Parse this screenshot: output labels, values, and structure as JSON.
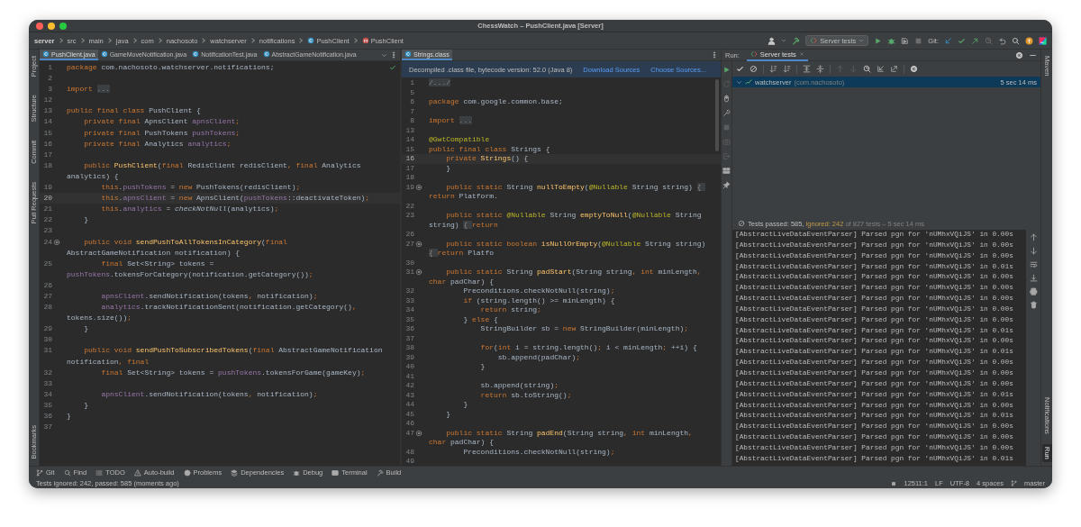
{
  "window": {
    "title": "ChessWatch – PushClient.java [Server]"
  },
  "navbar": {
    "breadcrumbs": [
      {
        "label": "server",
        "kind": "module"
      },
      {
        "label": "src",
        "kind": "folder"
      },
      {
        "label": "main",
        "kind": "folder"
      },
      {
        "label": "java",
        "kind": "folder"
      },
      {
        "label": "com",
        "kind": "folder"
      },
      {
        "label": "nachosoto",
        "kind": "folder"
      },
      {
        "label": "watchserver",
        "kind": "folder"
      },
      {
        "label": "notifications",
        "kind": "folder"
      },
      {
        "label": "PushClient",
        "kind": "class"
      },
      {
        "label": "PushClient",
        "kind": "method"
      }
    ],
    "run_configuration": "Server tests",
    "git_label": "Git:"
  },
  "left_strip": {
    "top": [
      {
        "label": "Project",
        "selected": false
      },
      {
        "label": "Structure",
        "selected": false
      },
      {
        "label": "Commit",
        "selected": false
      },
      {
        "label": "Pull Requests",
        "selected": false
      }
    ],
    "bottom": [
      {
        "label": "Bookmarks",
        "selected": false
      }
    ]
  },
  "editors": [
    {
      "tabs": [
        {
          "label": "PushClient.java",
          "selected": true
        },
        {
          "label": "GameMoveNotification.java",
          "selected": false
        },
        {
          "label": "NotificationTest.java",
          "selected": false
        },
        {
          "label": "AbstractGameNotification.java",
          "selected": false
        }
      ],
      "lines": [
        {
          "n": "1",
          "code": [
            {
              "kind": "keyword",
              "text": "package "
            },
            {
              "kind": "plain",
              "text": "com.nachosoto.watchserver.notifications;"
            }
          ]
        },
        {
          "n": "2"
        },
        {
          "n": "3",
          "code": [
            {
              "kind": "keyword",
              "text": "import "
            },
            {
              "kind": "folded",
              "text": "..."
            }
          ]
        },
        {
          "n": "12"
        },
        {
          "n": "13",
          "code": [
            {
              "kind": "keyword",
              "text": "public final class "
            },
            {
              "kind": "plain",
              "text": "PushClient {"
            }
          ]
        },
        {
          "n": "14",
          "code": [
            {
              "kind": "keyword",
              "text": "    private final "
            },
            {
              "kind": "plain",
              "text": "ApnsClient "
            },
            {
              "kind": "field",
              "text": "apnsClient"
            },
            {
              "kind": "keyword",
              "text": ";"
            }
          ]
        },
        {
          "n": "15",
          "code": [
            {
              "kind": "keyword",
              "text": "    private final "
            },
            {
              "kind": "plain",
              "text": "PushTokens "
            },
            {
              "kind": "field",
              "text": "pushTokens"
            },
            {
              "kind": "keyword",
              "text": ";"
            }
          ]
        },
        {
          "n": "16",
          "code": [
            {
              "kind": "keyword",
              "text": "    private final "
            },
            {
              "kind": "plain",
              "text": "Analytics "
            },
            {
              "kind": "field",
              "text": "analytics"
            },
            {
              "kind": "keyword",
              "text": ";"
            }
          ]
        },
        {
          "n": "17"
        },
        {
          "n": "18",
          "code": [
            {
              "kind": "keyword",
              "text": "    public "
            },
            {
              "kind": "declaration",
              "text": "PushClient"
            },
            {
              "kind": "plain",
              "text": "("
            },
            {
              "kind": "keyword",
              "text": "final "
            },
            {
              "kind": "plain",
              "text": "RedisClient redisClient"
            },
            {
              "kind": "keyword",
              "text": ", final "
            },
            {
              "kind": "plain",
              "text": "Analytics analytics) {"
            }
          ]
        },
        {
          "n": "19",
          "code": [
            {
              "kind": "keyword",
              "text": "        this"
            },
            {
              "kind": "plain",
              "text": "."
            },
            {
              "kind": "field",
              "text": "pushTokens"
            },
            {
              "kind": "plain",
              "text": " = "
            },
            {
              "kind": "keyword",
              "text": "new "
            },
            {
              "kind": "plain",
              "text": "PushTokens(redisClient)"
            },
            {
              "kind": "keyword",
              "text": ";"
            }
          ]
        },
        {
          "n": "20",
          "current": true,
          "code": [
            {
              "kind": "keyword",
              "text": "        this"
            },
            {
              "kind": "plain",
              "text": "."
            },
            {
              "kind": "field",
              "text": "apnsClient"
            },
            {
              "kind": "plain",
              "text": " = "
            },
            {
              "kind": "keyword",
              "text": "new "
            },
            {
              "kind": "plain",
              "text": "ApnsClient("
            },
            {
              "kind": "field",
              "text": "pushTokens"
            },
            {
              "kind": "plain",
              "text": "::deactivateToken)"
            },
            {
              "kind": "keyword",
              "text": ";"
            }
          ]
        },
        {
          "n": "21",
          "code": [
            {
              "kind": "keyword",
              "text": "        this"
            },
            {
              "kind": "plain",
              "text": "."
            },
            {
              "kind": "field",
              "text": "analytics"
            },
            {
              "kind": "plain",
              "text": " = "
            },
            {
              "kind": "call",
              "text": "checkNotNull"
            },
            {
              "kind": "plain",
              "text": "(analytics)"
            },
            {
              "kind": "keyword",
              "text": ";"
            }
          ]
        },
        {
          "n": "22",
          "code": [
            {
              "kind": "plain",
              "text": "    }"
            }
          ]
        },
        {
          "n": "23"
        },
        {
          "n": "24",
          "marker": true,
          "code": [
            {
              "kind": "keyword",
              "text": "    public void "
            },
            {
              "kind": "declaration",
              "text": "sendPushToAllTokensInCategory"
            },
            {
              "kind": "plain",
              "text": "("
            },
            {
              "kind": "keyword",
              "text": "final "
            },
            {
              "kind": "plain",
              "text": "AbstractGameNotification notification) {"
            }
          ]
        },
        {
          "n": "25",
          "code": [
            {
              "kind": "keyword",
              "text": "        final "
            },
            {
              "kind": "plain",
              "text": "Set<String> tokens = "
            },
            {
              "kind": "field",
              "text": "pushTokens"
            },
            {
              "kind": "plain",
              "text": ".tokensForCategory(notification.getCategory())"
            },
            {
              "kind": "keyword",
              "text": ";"
            }
          ]
        },
        {
          "n": "26"
        },
        {
          "n": "27",
          "code": [
            {
              "kind": "field",
              "text": "        apnsClient"
            },
            {
              "kind": "plain",
              "text": ".sendNotification(tokens"
            },
            {
              "kind": "keyword",
              "text": ", "
            },
            {
              "kind": "plain",
              "text": "notification)"
            },
            {
              "kind": "keyword",
              "text": ";"
            }
          ]
        },
        {
          "n": "28",
          "code": [
            {
              "kind": "field",
              "text": "        analytics"
            },
            {
              "kind": "plain",
              "text": ".trackNotificationSent(notification.getCategory()"
            },
            {
              "kind": "keyword",
              "text": ", "
            },
            {
              "kind": "plain",
              "text": "tokens.size())"
            },
            {
              "kind": "keyword",
              "text": ";"
            }
          ]
        },
        {
          "n": "29",
          "code": [
            {
              "kind": "plain",
              "text": "    }"
            }
          ]
        },
        {
          "n": "30"
        },
        {
          "n": "31",
          "code": [
            {
              "kind": "keyword",
              "text": "    public void "
            },
            {
              "kind": "declaration",
              "text": "sendPushToSubscribedTokens"
            },
            {
              "kind": "plain",
              "text": "("
            },
            {
              "kind": "keyword",
              "text": "final "
            },
            {
              "kind": "plain",
              "text": "AbstractGameNotification notification"
            },
            {
              "kind": "keyword",
              "text": ", final"
            }
          ]
        },
        {
          "n": "32",
          "code": [
            {
              "kind": "keyword",
              "text": "        final "
            },
            {
              "kind": "plain",
              "text": "Set<String> tokens = "
            },
            {
              "kind": "field",
              "text": "pushTokens"
            },
            {
              "kind": "plain",
              "text": ".tokensForGame(gameKey)"
            },
            {
              "kind": "keyword",
              "text": ";"
            }
          ]
        },
        {
          "n": "33"
        },
        {
          "n": "34",
          "code": [
            {
              "kind": "field",
              "text": "        apnsClient"
            },
            {
              "kind": "plain",
              "text": ".sendNotification(tokens"
            },
            {
              "kind": "keyword",
              "text": ", "
            },
            {
              "kind": "plain",
              "text": "notification)"
            },
            {
              "kind": "keyword",
              "text": ";"
            }
          ]
        },
        {
          "n": "35",
          "code": [
            {
              "kind": "plain",
              "text": "    }"
            }
          ]
        },
        {
          "n": "36",
          "code": [
            {
              "kind": "plain",
              "text": "}"
            }
          ]
        },
        {
          "n": "37"
        }
      ]
    },
    {
      "tabs": [
        {
          "label": "Strings.class",
          "selected": true
        }
      ],
      "banner": {
        "message": "Decompiled .class file, bytecode version: 52.0 (Java 8)",
        "links": [
          "Download Sources",
          "Choose Sources..."
        ]
      },
      "lines": [
        {
          "n": "1",
          "code": [
            {
              "kind": "folded",
              "text": "/.../"
            }
          ]
        },
        {
          "n": "5"
        },
        {
          "n": "6",
          "code": [
            {
              "kind": "keyword",
              "text": "package "
            },
            {
              "kind": "plain",
              "text": "com.google.common.base;"
            }
          ]
        },
        {
          "n": "7"
        },
        {
          "n": "8",
          "code": [
            {
              "kind": "keyword",
              "text": "import "
            },
            {
              "kind": "folded",
              "text": "..."
            }
          ]
        },
        {
          "n": "13"
        },
        {
          "n": "14",
          "code": [
            {
              "kind": "annotation",
              "text": "@GwtCompatible"
            }
          ]
        },
        {
          "n": "15",
          "code": [
            {
              "kind": "keyword",
              "text": "public final class "
            },
            {
              "kind": "plain",
              "text": "Strings {"
            }
          ]
        },
        {
          "n": "16",
          "current": true,
          "code": [
            {
              "kind": "keyword",
              "text": "    private "
            },
            {
              "kind": "declaration",
              "text": "Strings"
            },
            {
              "kind": "plain",
              "text": "() {"
            }
          ]
        },
        {
          "n": "17",
          "code": [
            {
              "kind": "plain",
              "text": "    }"
            }
          ]
        },
        {
          "n": "18"
        },
        {
          "n": "19",
          "marker": true,
          "code": [
            {
              "kind": "keyword",
              "text": "    public static "
            },
            {
              "kind": "plain",
              "text": "String "
            },
            {
              "kind": "declaration",
              "text": "nullToEmpty"
            },
            {
              "kind": "plain",
              "text": "("
            },
            {
              "kind": "annotation",
              "text": "@Nullable "
            },
            {
              "kind": "plain",
              "text": "String string) "
            },
            {
              "kind": "folded",
              "text": "{ "
            },
            {
              "kind": "keyword",
              "text": "return "
            },
            {
              "kind": "plain",
              "text": "Platform."
            }
          ]
        },
        {
          "n": "22"
        },
        {
          "n": "23",
          "code": [
            {
              "kind": "keyword",
              "text": "    public static "
            },
            {
              "kind": "annotation",
              "text": "@Nullable "
            },
            {
              "kind": "plain",
              "text": "String "
            },
            {
              "kind": "declaration",
              "text": "emptyToNull"
            },
            {
              "kind": "plain",
              "text": "("
            },
            {
              "kind": "annotation",
              "text": "@Nullable "
            },
            {
              "kind": "plain",
              "text": "String string) "
            },
            {
              "kind": "folded",
              "text": "{ "
            },
            {
              "kind": "keyword",
              "text": "return"
            }
          ]
        },
        {
          "n": "26"
        },
        {
          "n": "27",
          "marker": true,
          "code": [
            {
              "kind": "keyword",
              "text": "    public static boolean "
            },
            {
              "kind": "declaration",
              "text": "isNullOrEmpty"
            },
            {
              "kind": "plain",
              "text": "("
            },
            {
              "kind": "annotation",
              "text": "@Nullable "
            },
            {
              "kind": "plain",
              "text": "String string) "
            },
            {
              "kind": "folded",
              "text": "{ "
            },
            {
              "kind": "keyword",
              "text": "return "
            },
            {
              "kind": "plain",
              "text": "Platfo"
            }
          ]
        },
        {
          "n": "30"
        },
        {
          "n": "31",
          "marker": true,
          "code": [
            {
              "kind": "keyword",
              "text": "    public static "
            },
            {
              "kind": "plain",
              "text": "String "
            },
            {
              "kind": "declaration",
              "text": "padStart"
            },
            {
              "kind": "plain",
              "text": "(String string"
            },
            {
              "kind": "keyword",
              "text": ", int "
            },
            {
              "kind": "plain",
              "text": "minLength"
            },
            {
              "kind": "keyword",
              "text": ", char "
            },
            {
              "kind": "plain",
              "text": "padChar) {"
            }
          ]
        },
        {
          "n": "32",
          "code": [
            {
              "kind": "plain",
              "text": "        Preconditions.checkNotNull(string)"
            },
            {
              "kind": "keyword",
              "text": ";"
            }
          ]
        },
        {
          "n": "33",
          "code": [
            {
              "kind": "keyword",
              "text": "        if "
            },
            {
              "kind": "plain",
              "text": "(string.length() >= minLength) {"
            }
          ]
        },
        {
          "n": "34",
          "code": [
            {
              "kind": "keyword",
              "text": "            return "
            },
            {
              "kind": "plain",
              "text": "string"
            },
            {
              "kind": "keyword",
              "text": ";"
            }
          ]
        },
        {
          "n": "35",
          "code": [
            {
              "kind": "plain",
              "text": "        } "
            },
            {
              "kind": "keyword",
              "text": "else "
            },
            {
              "kind": "plain",
              "text": "{"
            }
          ]
        },
        {
          "n": "36",
          "code": [
            {
              "kind": "plain",
              "text": "            StringBuilder sb = "
            },
            {
              "kind": "keyword",
              "text": "new "
            },
            {
              "kind": "plain",
              "text": "StringBuilder(minLength)"
            },
            {
              "kind": "keyword",
              "text": ";"
            }
          ]
        },
        {
          "n": "37"
        },
        {
          "n": "38",
          "code": [
            {
              "kind": "keyword",
              "text": "            for"
            },
            {
              "kind": "plain",
              "text": "("
            },
            {
              "kind": "keyword",
              "text": "int "
            },
            {
              "kind": "plain",
              "text": "i = string.length()"
            },
            {
              "kind": "keyword",
              "text": "; "
            },
            {
              "kind": "plain",
              "text": "i < minLength"
            },
            {
              "kind": "keyword",
              "text": "; "
            },
            {
              "kind": "plain",
              "text": "++i) {"
            }
          ]
        },
        {
          "n": "39",
          "code": [
            {
              "kind": "plain",
              "text": "                sb.append(padChar)"
            },
            {
              "kind": "keyword",
              "text": ";"
            }
          ]
        },
        {
          "n": "40",
          "code": [
            {
              "kind": "plain",
              "text": "            }"
            }
          ]
        },
        {
          "n": "41"
        },
        {
          "n": "42",
          "code": [
            {
              "kind": "plain",
              "text": "            sb.append(string)"
            },
            {
              "kind": "keyword",
              "text": ";"
            }
          ]
        },
        {
          "n": "43",
          "code": [
            {
              "kind": "keyword",
              "text": "            return "
            },
            {
              "kind": "plain",
              "text": "sb.toString()"
            },
            {
              "kind": "keyword",
              "text": ";"
            }
          ]
        },
        {
          "n": "44",
          "code": [
            {
              "kind": "plain",
              "text": "        }"
            }
          ]
        },
        {
          "n": "45",
          "code": [
            {
              "kind": "plain",
              "text": "    }"
            }
          ]
        },
        {
          "n": "46"
        },
        {
          "n": "47",
          "marker": true,
          "code": [
            {
              "kind": "keyword",
              "text": "    public static "
            },
            {
              "kind": "plain",
              "text": "String "
            },
            {
              "kind": "declaration",
              "text": "padEnd"
            },
            {
              "kind": "plain",
              "text": "(String string"
            },
            {
              "kind": "keyword",
              "text": ", int "
            },
            {
              "kind": "plain",
              "text": "minLength"
            },
            {
              "kind": "keyword",
              "text": ", char "
            },
            {
              "kind": "plain",
              "text": "padChar) {"
            }
          ]
        },
        {
          "n": "48",
          "code": [
            {
              "kind": "plain",
              "text": "        Preconditions.checkNotNull(string)"
            },
            {
              "kind": "keyword",
              "text": ";"
            }
          ]
        },
        {
          "n": "49"
        }
      ]
    }
  ],
  "run_panel": {
    "label": "Run:",
    "tabs": [
      {
        "label": "Server tests",
        "selected": true
      }
    ],
    "tree": [
      {
        "name": "watchserver",
        "package": "(com.nachosoto)",
        "duration": "5 sec 14 ms",
        "selected": true,
        "expanded": true
      }
    ],
    "summary": {
      "passed": "Tests passed: 585,",
      "ignored": "ignored: 242",
      "rest": "of 827 tests – 5 sec 14 ms"
    },
    "console": [
      "[AbstractLiveDataEventParser] Parsed pgn for 'nUMhxVQiJS' in 0.00s",
      "[AbstractLiveDataEventParser] Parsed pgn for 'nUMhxVQiJS' in 0.00s",
      "[AbstractLiveDataEventParser] Parsed pgn for 'nUMhxVQiJS' in 0.00s",
      "[AbstractLiveDataEventParser] Parsed pgn for 'nUMhxVQiJS' in 0.01s",
      "[AbstractLiveDataEventParser] Parsed pgn for 'nUMhxVQiJS' in 0.00s",
      "[AbstractLiveDataEventParser] Parsed pgn for 'nUMhxVQiJS' in 0.00s",
      "[AbstractLiveDataEventParser] Parsed pgn for 'nUMhxVQiJS' in 0.00s",
      "[AbstractLiveDataEventParser] Parsed pgn for 'nUMhxVQiJS' in 0.00s",
      "[AbstractLiveDataEventParser] Parsed pgn for 'nUMhxVQiJS' in 0.00s",
      "[AbstractLiveDataEventParser] Parsed pgn for 'nUMhxVQiJS' in 0.01s",
      "[AbstractLiveDataEventParser] Parsed pgn for 'nUMhxVQiJS' in 0.00s",
      "[AbstractLiveDataEventParser] Parsed pgn for 'nUMhxVQiJS' in 0.01s",
      "[AbstractLiveDataEventParser] Parsed pgn for 'nUMhxVQiJS' in 0.00s",
      "[AbstractLiveDataEventParser] Parsed pgn for 'nUMhxVQiJS' in 0.00s",
      "[AbstractLiveDataEventParser] Parsed pgn for 'nUMhxVQiJS' in 0.00s",
      "[AbstractLiveDataEventParser] Parsed pgn for 'nUMhxVQiJS' in 0.01s",
      "[AbstractLiveDataEventParser] Parsed pgn for 'nUMhxVQiJS' in 0.00s",
      "[AbstractLiveDataEventParser] Parsed pgn for 'nUMhxVQiJS' in 0.01s",
      "[AbstractLiveDataEventParser] Parsed pgn for 'nUMhxVQiJS' in 0.00s",
      "[AbstractLiveDataEventParser] Parsed pgn for 'nUMhxVQiJS' in 0.00s",
      "[AbstractLiveDataEventParser] Parsed pgn for 'nUMhxVQiJS' in 0.00s",
      "[AbstractLiveDataEventParser] Parsed pgn for 'nUMhxVQiJS' in 0.01s"
    ]
  },
  "right_strip": {
    "top": [
      {
        "label": "Maven",
        "selected": false
      }
    ],
    "bottom": [
      {
        "label": "Notifications",
        "selected": false
      },
      {
        "label": "Run",
        "selected": true
      }
    ]
  },
  "tool_bar": [
    "Git",
    "Find",
    "TODO",
    "Auto-build",
    "Problems",
    "Dependencies",
    "Debug",
    "Terminal",
    "Build"
  ],
  "status_bar": {
    "message": "Tests ignored: 242, passed: 585 (moments ago)",
    "items": [
      "12511:1",
      "LF",
      "UTF-8",
      "4 spaces",
      "master"
    ]
  }
}
